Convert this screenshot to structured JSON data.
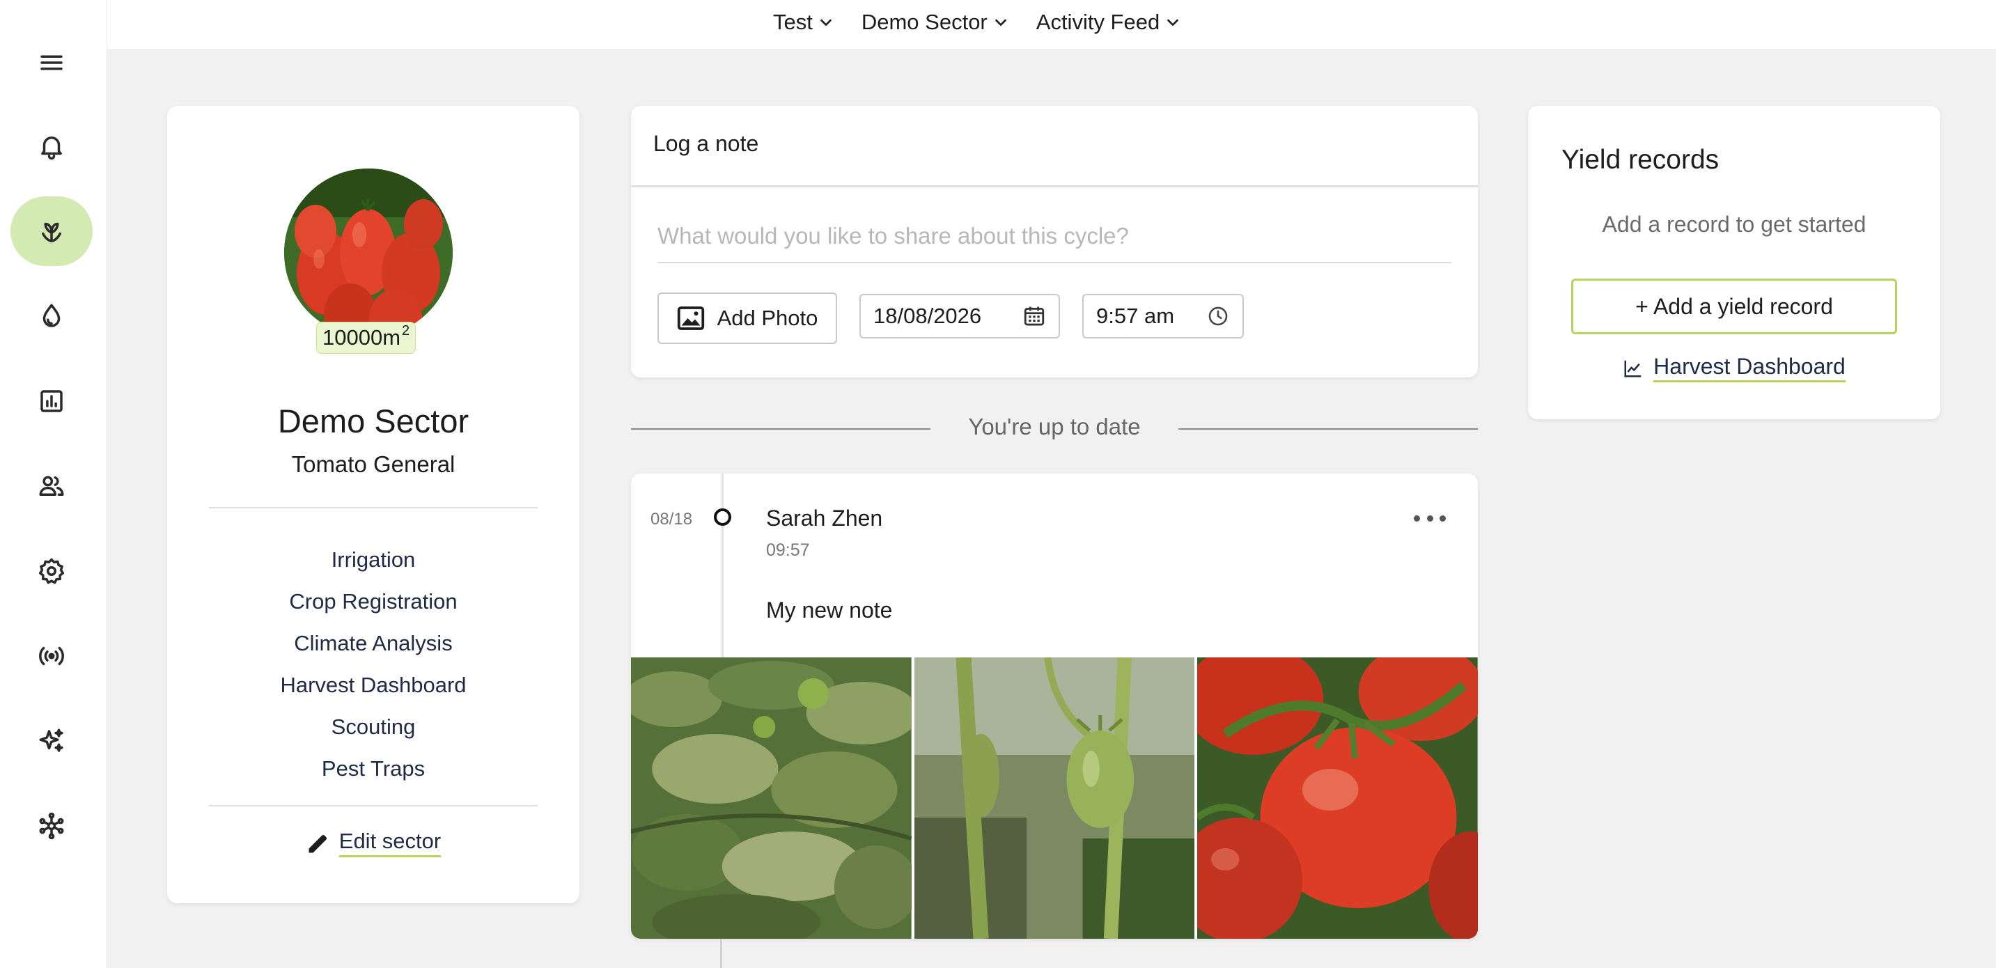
{
  "topnav": {
    "items": [
      {
        "label": "Test"
      },
      {
        "label": "Demo Sector"
      },
      {
        "label": "Activity Feed"
      }
    ]
  },
  "rail": {
    "items": [
      {
        "icon": "bell-icon"
      },
      {
        "icon": "sprout-icon",
        "active": true
      },
      {
        "icon": "water-drop-icon"
      },
      {
        "icon": "bar-chart-icon"
      },
      {
        "icon": "people-icon"
      },
      {
        "icon": "gear-icon"
      },
      {
        "icon": "sensor-icon"
      },
      {
        "icon": "sparkles-icon"
      },
      {
        "icon": "network-icon"
      }
    ]
  },
  "sector": {
    "area": "10000m",
    "area_sup": "2",
    "name": "Demo Sector",
    "crop": "Tomato General",
    "links": [
      "Irrigation",
      "Crop Registration",
      "Climate Analysis",
      "Harvest Dashboard",
      "Scouting",
      "Pest Traps"
    ],
    "edit_label": "Edit sector"
  },
  "note": {
    "title": "Log a note",
    "placeholder": "What would you like to share about this cycle?",
    "add_photo_label": "Add Photo",
    "date": "18/08/2026",
    "time": "9:57 am"
  },
  "status": {
    "up_to_date": "You're up to date"
  },
  "feed": {
    "items": [
      {
        "date": "08/18",
        "author": "Sarah Zhen",
        "time": "09:57",
        "text": "My new note"
      }
    ]
  },
  "yield": {
    "title": "Yield records",
    "empty": "Add a record to get started",
    "add_label": "+ Add a yield record",
    "dashboard_label": "Harvest Dashboard"
  },
  "colors": {
    "accent": "#b8d35b",
    "active_nav": "#d3ebb2",
    "background": "#f1f1f1"
  }
}
